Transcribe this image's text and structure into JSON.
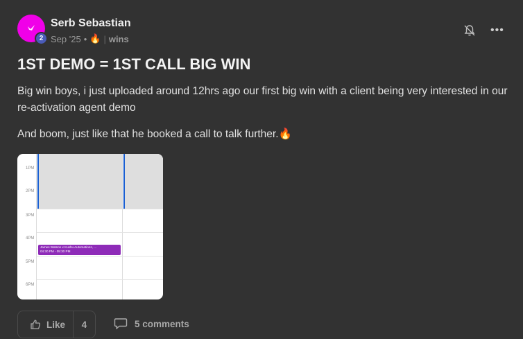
{
  "post": {
    "author": "Serb Sebastian",
    "level": "2",
    "date": "Sep '25",
    "bullet": "•",
    "fire_emoji": "🔥",
    "separator": "|",
    "category": "wins",
    "more_glyph": "•••",
    "title": "1ST DEMO = 1ST CALL BIG WIN",
    "paragraphs": [
      "Big win boys, i just uploaded around 12hrs ago our first big win with a client being very interested in our re-activation agent demo",
      "And boom, just like that he booked a call to talk further.🔥"
    ]
  },
  "attachment": {
    "hours": [
      "1PM",
      "2PM",
      "3PM",
      "4PM",
      "5PM",
      "6PM"
    ],
    "event_title": "James Watson x Kushu Automations, ...",
    "event_time": "04:30 PM - 05:30 PM",
    "event_color": "#8e2bb8",
    "now_line_color": "#1a5fd1"
  },
  "actions": {
    "like_label": "Like",
    "like_count": "4",
    "comments_label": "5 comments"
  },
  "colors": {
    "background": "#323232",
    "avatar": "#f000e8",
    "level_badge": "#4a5bb8"
  },
  "icons": [
    "notification-bell-icon",
    "more-options-icon",
    "thumbs-up-icon",
    "comment-bubble-icon",
    "avatar-bird-icon"
  ]
}
